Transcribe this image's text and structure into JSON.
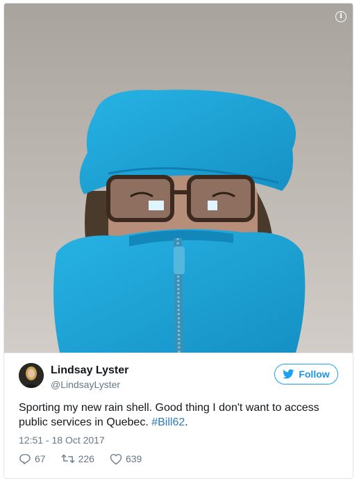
{
  "tweet": {
    "author_name": "Lindsay Lyster",
    "author_handle": "@LindsayLyster",
    "follow_label": "Follow",
    "text_main": "Sporting my new rain shell. Good thing I don't want to access public services in Quebec. ",
    "hashtag": "#Bill62",
    "text_end": ".",
    "timestamp": "12:51 - 18 Oct 2017",
    "replies": "67",
    "retweets": "226",
    "likes": "639"
  },
  "icons": {
    "info": "info-icon",
    "follow": "twitter-bird-icon",
    "reply": "reply-icon",
    "retweet": "retweet-icon",
    "like": "heart-icon"
  },
  "colors": {
    "accent": "#1da1f2",
    "link": "#2b7bb9",
    "muted": "#657786",
    "jacket": "#1ba0d4"
  }
}
